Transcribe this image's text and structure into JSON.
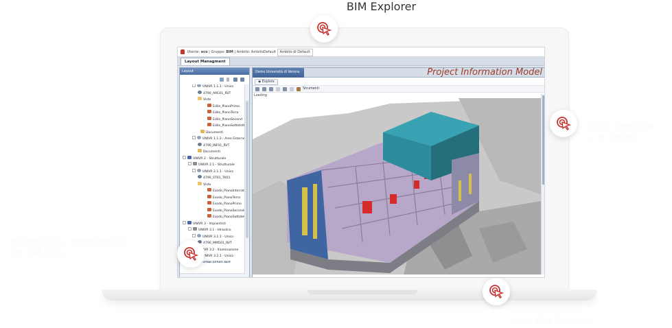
{
  "page": {
    "title": "BIM Explorer"
  },
  "annotations": [
    {
      "id": "right",
      "lines": [
        "Aree Direzione",
        "e di Sintesi"
      ]
    },
    {
      "id": "left",
      "lines": [
        "Interazione e integrazione",
        "con FM e DL"
      ]
    },
    {
      "id": "bottom",
      "lines": [
        "Aree BIM Manager"
      ]
    }
  ],
  "app": {
    "userbar": {
      "utente_label": "Utente:",
      "utente": "eco",
      "gruppo_label": "| Gruppo:",
      "gruppo": "BIM",
      "ambito_label": "| Ambito: AmbitoDefault",
      "ambito_box": "Ambito di Default"
    },
    "layout_tab": "Layout Managment",
    "left_panel": {
      "header": "Layout",
      "tree": [
        {
          "label": "UNIVR 1.1.1 - Unico",
          "icon": "eye"
        },
        {
          "label": "4790_ARC01_RVT",
          "icon": "model"
        },
        {
          "label": "Viste",
          "icon": "folder"
        },
        {
          "label": "Edile_PianoPrimo",
          "icon": "view"
        },
        {
          "label": "Edile_PianoTerra",
          "icon": "view"
        },
        {
          "label": "Edile_PianoSecond",
          "icon": "view"
        },
        {
          "label": "Edile_PianoSottotetto",
          "icon": "view"
        },
        {
          "label": "Documenti",
          "icon": "doc"
        },
        {
          "label": "UNIVR 1.1.2 - Aree Esterne",
          "icon": "eye"
        },
        {
          "label": "4790_INF01_RVT",
          "icon": "model"
        },
        {
          "label": "Documenti",
          "icon": "doc"
        },
        {
          "label": "UNIVR 2 - Strutturale",
          "icon": "build"
        },
        {
          "label": "UNIVR 2.1 - Strutturale",
          "icon": "struct"
        },
        {
          "label": "UNIVR 2.1.1 - Unico",
          "icon": "eye"
        },
        {
          "label": "4790_ST01_TK01",
          "icon": "model"
        },
        {
          "label": "Viste",
          "icon": "folder"
        },
        {
          "label": "Esodo_PianoInterrato",
          "icon": "view"
        },
        {
          "label": "Esodo_PianoTerra",
          "icon": "view"
        },
        {
          "label": "Esodo_PianoPrimo",
          "icon": "view"
        },
        {
          "label": "Esodo_PianoSecondo",
          "icon": "view"
        },
        {
          "label": "Esodo_PianoSottotetto",
          "icon": "view"
        },
        {
          "label": "UNIVR 3 - Impiantisti",
          "icon": "build"
        },
        {
          "label": "UNIVR 3.1 - Idraulico",
          "icon": "struct"
        },
        {
          "label": "UNIVR 3.1.1 - Unico",
          "icon": "eye"
        },
        {
          "label": "4790_MM501_RVT",
          "icon": "model"
        },
        {
          "label": "UNIVR 3.2 - Illuminazione",
          "icon": "struct"
        },
        {
          "label": "UNIVR 3.2.1 - Unico",
          "icon": "eye"
        },
        {
          "label": "4790_EE501_RVT",
          "icon": "model"
        }
      ]
    },
    "main_panel": {
      "tab": "Demo Università di Verona",
      "title": "Project Information Model",
      "explore_button": "Explore",
      "tools_label": "Strumenti",
      "loading": "Loading"
    }
  }
}
